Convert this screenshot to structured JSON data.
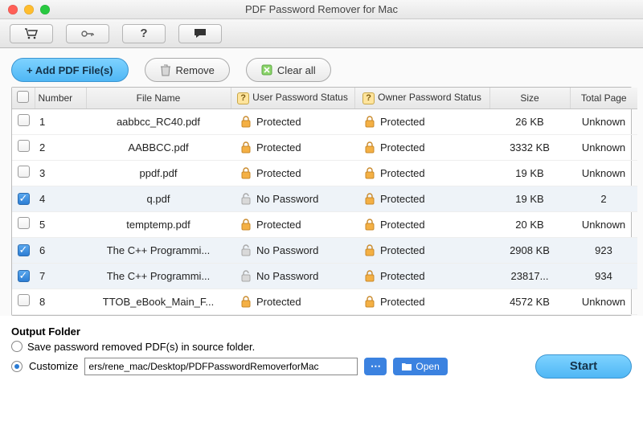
{
  "window": {
    "title": "PDF Password Remover for Mac"
  },
  "toolbar": {
    "cart": "cart-icon",
    "key": "key-icon",
    "help": "help-icon",
    "feedback": "feedback-icon"
  },
  "actions": {
    "add": "+ Add PDF File(s)",
    "remove": "Remove",
    "clear": "Clear all"
  },
  "columns": {
    "number": "Number",
    "filename": "File Name",
    "user": "User Password Status",
    "owner": "Owner Password Status",
    "size": "Size",
    "total": "Total Page"
  },
  "status": {
    "protected": "Protected",
    "nopassword": "No Password"
  },
  "rows": [
    {
      "n": "1",
      "file": "aabbcc_RC40.pdf",
      "user": "protected",
      "owner": "protected",
      "size": "26 KB",
      "pages": "Unknown",
      "checked": false
    },
    {
      "n": "2",
      "file": "AABBCC.pdf",
      "user": "protected",
      "owner": "protected",
      "size": "3332 KB",
      "pages": "Unknown",
      "checked": false
    },
    {
      "n": "3",
      "file": "ppdf.pdf",
      "user": "protected",
      "owner": "protected",
      "size": "19 KB",
      "pages": "Unknown",
      "checked": false
    },
    {
      "n": "4",
      "file": "q.pdf",
      "user": "nopassword",
      "owner": "protected",
      "size": "19 KB",
      "pages": "2",
      "checked": true
    },
    {
      "n": "5",
      "file": "temptemp.pdf",
      "user": "protected",
      "owner": "protected",
      "size": "20 KB",
      "pages": "Unknown",
      "checked": false
    },
    {
      "n": "6",
      "file": "The C++ Programmi...",
      "user": "nopassword",
      "owner": "protected",
      "size": "2908 KB",
      "pages": "923",
      "checked": true
    },
    {
      "n": "7",
      "file": "The C++ Programmi...",
      "user": "nopassword",
      "owner": "protected",
      "size": "23817...",
      "pages": "934",
      "checked": true
    },
    {
      "n": "8",
      "file": "TTOB_eBook_Main_F...",
      "user": "protected",
      "owner": "protected",
      "size": "4572 KB",
      "pages": "Unknown",
      "checked": false
    }
  ],
  "output": {
    "heading": "Output Folder",
    "saveInSource": "Save password removed PDF(s) in source folder.",
    "customize": "Customize",
    "path": "ers/rene_mac/Desktop/PDFPasswordRemoverforMac",
    "open": "Open",
    "start": "Start",
    "selected": "customize"
  }
}
